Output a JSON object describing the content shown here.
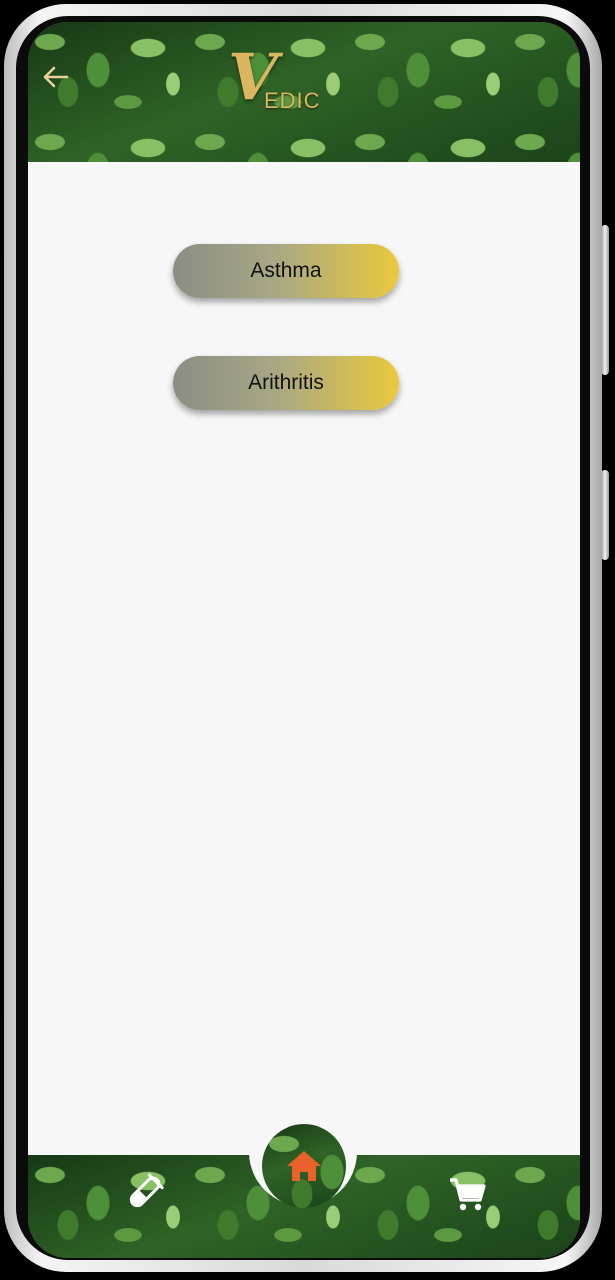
{
  "header": {
    "logo_initial": "V",
    "logo_rest": "EDIC",
    "back_icon": "arrow-left-icon"
  },
  "diseases": [
    {
      "label": "Asthma"
    },
    {
      "label": "Arithritis"
    }
  ],
  "bottom_nav": {
    "left_icon": "test-tube-icon",
    "center_icon": "home-icon",
    "right_icon": "cart-icon"
  },
  "colors": {
    "logo_gold": "#d9b65f",
    "button_gradient_start": "#8a8e82",
    "button_gradient_end": "#e9c93c",
    "home_accent": "#e8622a",
    "background": "#f7f7f7"
  }
}
